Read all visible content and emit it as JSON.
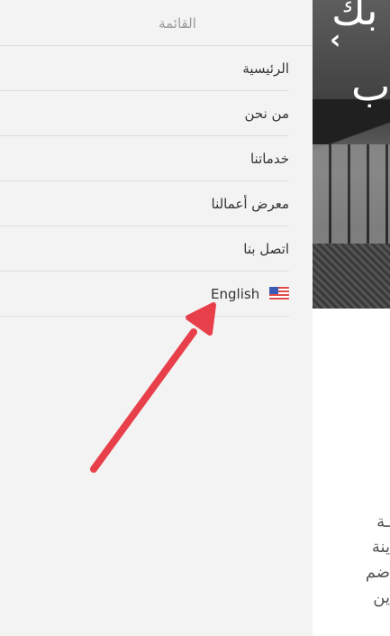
{
  "drawer": {
    "title": "القائمة",
    "items": [
      {
        "label": "الرئيسية"
      },
      {
        "label": "من نحن"
      },
      {
        "label": "خدماتنا"
      },
      {
        "label": "معرض أعمالنا"
      },
      {
        "label": "اتصل بنا"
      }
    ],
    "language": {
      "label": "English",
      "flag_icon": "us-flag-icon"
    }
  },
  "background": {
    "hero_text_1": "بك",
    "hero_text_2": "ب",
    "chevron_icon": "chevron-left-icon",
    "body_lines": [
      "ـة",
      "ينة",
      "ضم",
      "ين"
    ]
  },
  "annotation": {
    "color": "#e8404a",
    "icon": "arrow-icon"
  }
}
